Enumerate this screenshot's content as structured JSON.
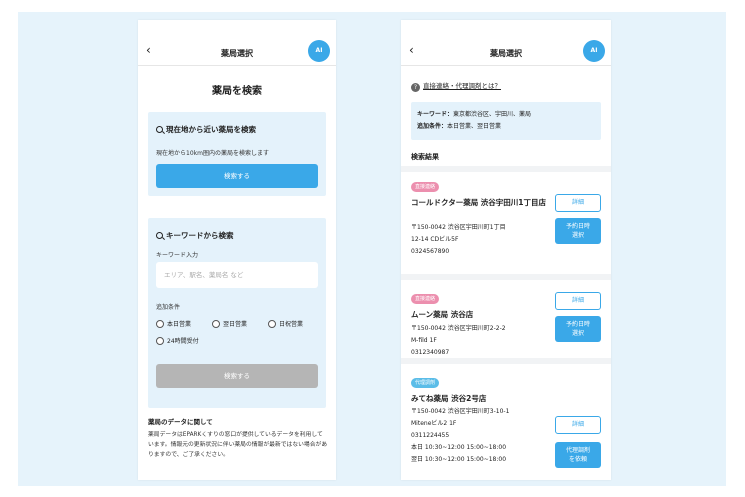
{
  "left_screen": {
    "header": {
      "back": "‹",
      "title": "薬局選択",
      "ai_badge": "AI"
    },
    "page_title": "薬局を検索",
    "location_card": {
      "title": "現在地から近い薬局を検索",
      "desc": "現在地から10km圏内の薬局を検索します",
      "button": "検索する"
    },
    "keyword_card": {
      "title": "キーワードから検索",
      "input_label": "キーワード入力",
      "input_placeholder": "エリア、駅名、薬局名 など",
      "filter_label": "追加条件",
      "options": [
        "本日営業",
        "翌日営業",
        "日祝営業",
        "24時間受付"
      ],
      "button": "検索する"
    },
    "about": {
      "title": "薬局のデータに関して",
      "body": "薬局データはEPARKくすりの窓口が提供しているデータを利用しています。情報元の更新状況に伴い薬局の情報が最新ではない場合がありますので、ご了承ください。"
    }
  },
  "right_screen": {
    "header": {
      "back": "‹",
      "title": "薬局選択",
      "ai_badge": "AI"
    },
    "help_link": "直接連絡・代理調剤とは？",
    "conditions": {
      "keyword_label": "キーワード：",
      "keyword_value": "東京都渋谷区、宇田川、薬局",
      "extra_label": "追加条件：",
      "extra_value": "本日営業、翌日営業"
    },
    "results_heading": "検索結果",
    "results": [
      {
        "tag": "直接連絡",
        "name": "コールドクター薬局 渋谷宇田川1丁目店",
        "lines": [
          "〒150-0042 渋谷区宇田川町1丁目",
          "12-14 CDビル5F",
          "0324567890"
        ],
        "detail_btn": "詳細",
        "action_btn": [
          "予約日時",
          "選択"
        ]
      },
      {
        "tag": "直接連絡",
        "name": "ムーン薬局 渋谷店",
        "lines": [
          "〒150-0042 渋谷区宇田川町2-2-2",
          "M-fild 1F",
          "0312340987"
        ],
        "detail_btn": "詳細",
        "action_btn": [
          "予約日時",
          "選択"
        ]
      },
      {
        "tag": "代理調剤",
        "name": "みてね薬局 渋谷2号店",
        "lines": [
          "〒150-0042 渋谷区宇田川町3-10-1",
          "Miteneビル2 1F",
          "0311224455",
          "本日 10:30~12:00 15:00~18:00",
          "翌日 10:30~12:00 15:00~18:00"
        ],
        "detail_btn": "詳細",
        "action_btn": [
          "代理調剤",
          "を依頼"
        ]
      }
    ]
  },
  "colors": {
    "accent": "#3aa8e8",
    "card_bg": "#e4f2fb",
    "tag_direct": "#ec8fae",
    "tag_proxy": "#5bbde8",
    "disabled": "#b5b5b5"
  }
}
